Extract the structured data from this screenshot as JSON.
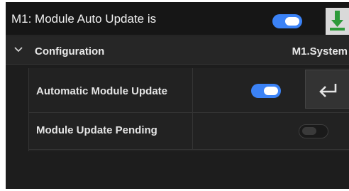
{
  "header": {
    "title": "M1: Module Auto Update is",
    "toggle_on": true
  },
  "config": {
    "label": "Configuration",
    "value": "M1.System"
  },
  "rows": [
    {
      "label": "Automatic Module Update",
      "toggle_on": true
    },
    {
      "label": "Module Update Pending",
      "toggle_on": false
    }
  ],
  "colors": {
    "toggle_on": "#3b82f6",
    "save_icon": "#2e9a3a",
    "background": "#1d1d1d"
  },
  "icons": {
    "save": "save-download-icon",
    "expand": "chevron-down-icon",
    "enter": "enter-return-icon"
  }
}
